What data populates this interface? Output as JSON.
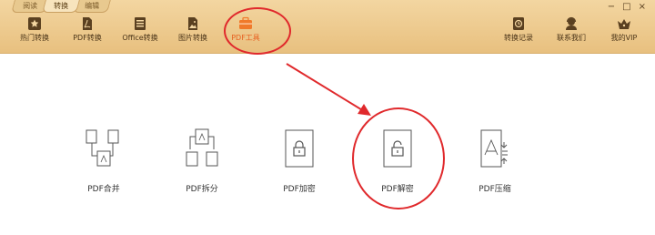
{
  "window": {
    "tabs": [
      "阅读",
      "转换",
      "编辑"
    ],
    "controls": [
      "−",
      "□",
      "×"
    ]
  },
  "toolbar": {
    "left": [
      {
        "label": "热门转换",
        "icon": "star-icon"
      },
      {
        "label": "PDF转换",
        "icon": "pdf-icon"
      },
      {
        "label": "Office转换",
        "icon": "office-icon"
      },
      {
        "label": "图片转换",
        "icon": "image-icon"
      },
      {
        "label": "PDF工具",
        "icon": "toolbox-icon"
      }
    ],
    "right": [
      {
        "label": "转换记录",
        "icon": "clock-icon"
      },
      {
        "label": "联系我们",
        "icon": "support-icon"
      },
      {
        "label": "我的VIP",
        "icon": "crown-icon"
      }
    ]
  },
  "tools": [
    {
      "label": "PDF合并",
      "icon": "merge-icon"
    },
    {
      "label": "PDF拆分",
      "icon": "split-icon"
    },
    {
      "label": "PDF加密",
      "icon": "lock-icon"
    },
    {
      "label": "PDF解密",
      "icon": "unlock-icon"
    },
    {
      "label": "PDF压缩",
      "icon": "compress-icon"
    }
  ],
  "colors": {
    "toolbar": "#e8c07f",
    "accent": "#e86020",
    "annotation": "#e0292c"
  }
}
